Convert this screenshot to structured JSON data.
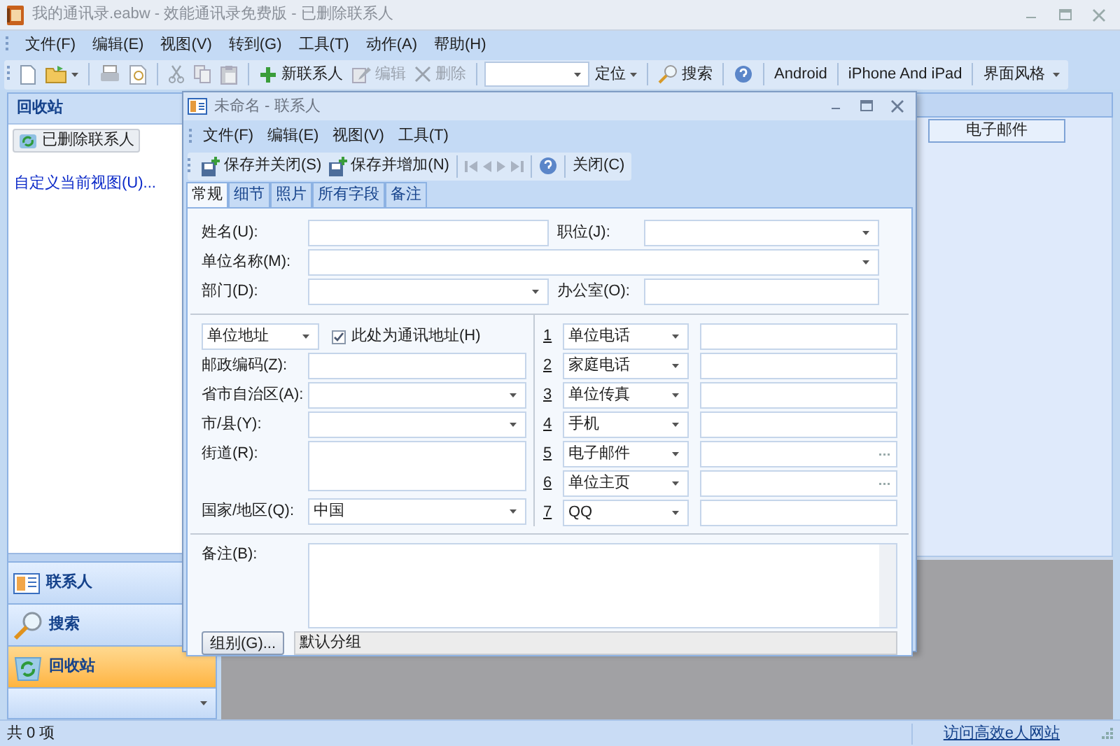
{
  "window": {
    "title": "我的通讯录.eabw - 效能通讯录免费版 - 已删除联系人"
  },
  "menu": [
    "文件(F)",
    "编辑(E)",
    "视图(V)",
    "转到(G)",
    "工具(T)",
    "动作(A)",
    "帮助(H)"
  ],
  "toolbar": {
    "new_contact": {
      "label": "新联系人",
      "disabled": false
    },
    "edit": {
      "label": "编辑",
      "disabled": true
    },
    "delete": {
      "label": "删除",
      "disabled": true
    },
    "locate": "定位",
    "search": "搜索",
    "android": "Android",
    "iphone": "iPhone And iPad",
    "theme": "界面风格"
  },
  "sidebar": {
    "header": "回收站",
    "folder": "已删除联系人",
    "customize_link": "自定义当前视图(U)...",
    "nav": [
      {
        "label": "联系人",
        "selected": false
      },
      {
        "label": "搜索",
        "selected": false
      },
      {
        "label": "回收站",
        "selected": true
      }
    ]
  },
  "grid": {
    "column_header": "电子邮件"
  },
  "status_bar": {
    "count": "共 0 项",
    "link": "访问高效e人网站"
  },
  "dialog": {
    "title": "未命名 - 联系人",
    "menu": [
      "文件(F)",
      "编辑(E)",
      "视图(V)",
      "工具(T)"
    ],
    "toolbar": {
      "save_close": "保存并关闭(S)",
      "save_add": "保存并增加(N)",
      "close": "关闭(C)"
    },
    "tabs": [
      {
        "label": "常规",
        "selected": true
      },
      {
        "label": "细节",
        "selected": false
      },
      {
        "label": "照片",
        "selected": false
      },
      {
        "label": "所有字段",
        "selected": false
      },
      {
        "label": "备注",
        "selected": false
      }
    ],
    "name_label": "姓名(U):",
    "job_label": "职位(J):",
    "company_label": "单位名称(M):",
    "department_label": "部门(D):",
    "office_label": "办公室(O):",
    "address_type": "单位地址",
    "mailing_checkbox": {
      "label": "此处为通讯地址(H)",
      "checked": true
    },
    "postal_label": "邮政编码(Z):",
    "province_label": "省市自治区(A):",
    "city_label": "市/县(Y):",
    "street_label": "街道(R):",
    "country_label": "国家/地区(Q):",
    "country_value": "中国",
    "phones": [
      {
        "number": "1",
        "type": "单位电话",
        "kind": "text"
      },
      {
        "number": "2",
        "type": "家庭电话",
        "kind": "text"
      },
      {
        "number": "3",
        "type": "单位传真",
        "kind": "text"
      },
      {
        "number": "4",
        "type": "手机",
        "kind": "text"
      },
      {
        "number": "5",
        "type": "电子邮件",
        "kind": "browse"
      },
      {
        "number": "6",
        "type": "单位主页",
        "kind": "browse"
      },
      {
        "number": "7",
        "type": "QQ",
        "kind": "text"
      }
    ],
    "notes_label": "备注(B):",
    "group_button": "组别(G)...",
    "group_value": "默认分组"
  }
}
